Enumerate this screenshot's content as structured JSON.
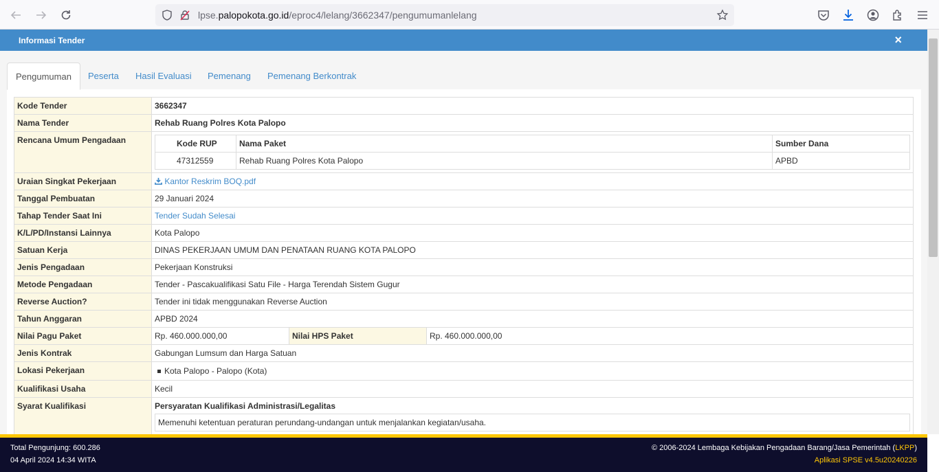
{
  "browser": {
    "url_prefix": "lpse.",
    "url_host": "palopokota.go.id",
    "url_path": "/eproc4/lelang/3662347/pengumumanlelang"
  },
  "modal": {
    "title": "Informasi Tender",
    "close_label": "×"
  },
  "tabs": [
    {
      "label": "Pengumuman"
    },
    {
      "label": "Peserta"
    },
    {
      "label": "Hasil Evaluasi"
    },
    {
      "label": "Pemenang"
    },
    {
      "label": "Pemenang Berkontrak"
    }
  ],
  "info": {
    "kode_tender": {
      "label": "Kode Tender",
      "value": "3662347"
    },
    "nama_tender": {
      "label": "Nama Tender",
      "value": "Rehab Ruang Polres Kota Palopo"
    },
    "rup": {
      "label": "Rencana Umum Pengadaan",
      "headers": [
        "Kode RUP",
        "Nama Paket",
        "Sumber Dana"
      ],
      "row": [
        "47312559",
        "Rehab Ruang Polres Kota Palopo",
        "APBD"
      ]
    },
    "uraian": {
      "label": "Uraian Singkat Pekerjaan",
      "value": "Kantor Reskrim BOQ.pdf"
    },
    "tanggal": {
      "label": "Tanggal Pembuatan",
      "value": "29 Januari 2024"
    },
    "tahap": {
      "label": "Tahap Tender Saat Ini",
      "value": "Tender Sudah Selesai"
    },
    "klpd": {
      "label": "K/L/PD/Instansi Lainnya",
      "value": "Kota Palopo"
    },
    "satker": {
      "label": "Satuan Kerja",
      "value": "DINAS PEKERJAAN UMUM DAN PENATAAN RUANG KOTA PALOPO"
    },
    "jenis_pengadaan": {
      "label": "Jenis Pengadaan",
      "value": "Pekerjaan Konstruksi"
    },
    "metode": {
      "label": "Metode Pengadaan",
      "value": "Tender - Pascakualifikasi Satu File - Harga Terendah Sistem Gugur"
    },
    "reverse": {
      "label": "Reverse Auction?",
      "value": "Tender ini tidak menggunakan Reverse Auction"
    },
    "tahun": {
      "label": "Tahun Anggaran",
      "value": "APBD 2024"
    },
    "pagu": {
      "label": "Nilai Pagu Paket",
      "value": "Rp. 460.000.000,00",
      "hps_label": "Nilai HPS Paket",
      "hps_value": "Rp. 460.000.000,00"
    },
    "kontrak": {
      "label": "Jenis Kontrak",
      "value": "Gabungan Lumsum dan Harga Satuan"
    },
    "lokasi": {
      "label": "Lokasi Pekerjaan",
      "value": "Kota Palopo - Palopo (Kota)"
    },
    "kualifikasi_usaha": {
      "label": "Kualifikasi Usaha",
      "value": "Kecil"
    },
    "syarat": {
      "label": "Syarat Kualifikasi",
      "heading": "Persyaratan Kualifikasi Administrasi/Legalitas",
      "item": "Memenuhi ketentuan peraturan perundang-undangan untuk menjalankan kegiatan/usaha."
    }
  },
  "footer": {
    "visitors": "Total Pengunjung: 600.286",
    "datetime": "04 April 2024 14:34 WITA",
    "copyright_pre": "© 2006-2024 Lembaga Kebijakan Pengadaan Barang/Jasa Pemerintah (",
    "copyright_link": "LKPP",
    "copyright_post": ")",
    "version": "Aplikasi SPSE v4.5u20240226"
  }
}
